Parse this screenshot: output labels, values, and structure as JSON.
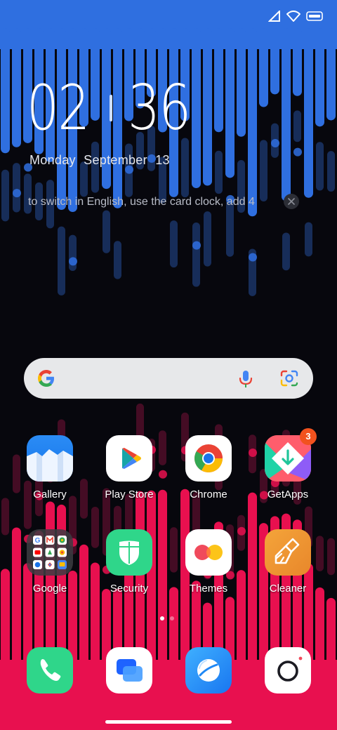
{
  "status_bar": {
    "icons": [
      "cellular-icon",
      "wifi-icon",
      "battery-icon"
    ]
  },
  "clock": {
    "hours": "02",
    "minutes": "36"
  },
  "date": {
    "weekday": "Monday",
    "month": "September",
    "day": "13"
  },
  "lockscreen_note": {
    "text": "to switch in English, use the card clock, add 4"
  },
  "search_bar": {
    "icons": [
      "google-logo-icon",
      "microphone-icon",
      "google-lens-icon"
    ]
  },
  "apps": {
    "row1": [
      {
        "label": "Gallery",
        "icon": "gallery-icon"
      },
      {
        "label": "Play Store",
        "icon": "play-store-icon"
      },
      {
        "label": "Chrome",
        "icon": "chrome-icon"
      },
      {
        "label": "GetApps",
        "icon": "getapps-icon",
        "badge": "3"
      }
    ],
    "row2": [
      {
        "label": "Google",
        "icon": "google-folder-icon"
      },
      {
        "label": "Security",
        "icon": "security-shield-icon"
      },
      {
        "label": "Themes",
        "icon": "themes-icon"
      },
      {
        "label": "Cleaner",
        "icon": "cleaner-brush-icon"
      }
    ]
  },
  "page_indicator": {
    "pages": 2,
    "current": 1
  },
  "dock": [
    {
      "icon": "phone-icon"
    },
    {
      "icon": "messages-icon"
    },
    {
      "icon": "browser-icon"
    },
    {
      "icon": "camera-icon"
    }
  ],
  "colors": {
    "wallpaper_top": "#2f6fe0",
    "wallpaper_bottom": "#e8104f",
    "background": "#07070d",
    "badge": "#f2521e"
  }
}
